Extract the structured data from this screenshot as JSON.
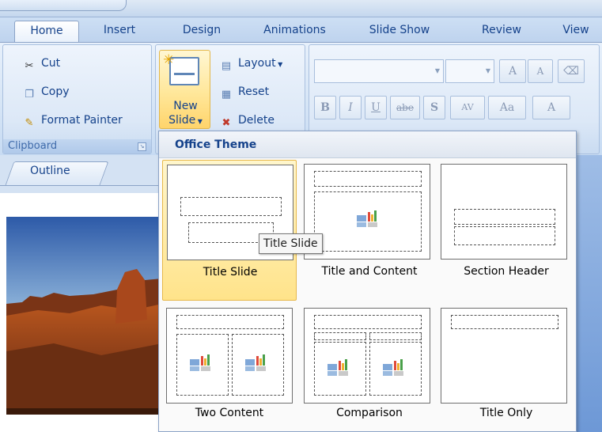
{
  "tabs": [
    {
      "label": "Home",
      "active": true
    },
    {
      "label": "Insert"
    },
    {
      "label": "Design"
    },
    {
      "label": "Animations"
    },
    {
      "label": "Slide Show"
    },
    {
      "label": "Review"
    },
    {
      "label": "View"
    }
  ],
  "clipboard": {
    "cut": "Cut",
    "copy": "Copy",
    "format_painter": "Format Painter",
    "group_label": "Clipboard"
  },
  "slides_group": {
    "new_slide_line1": "New",
    "new_slide_line2": "Slide",
    "layout": "Layout",
    "reset": "Reset",
    "delete": "Delete"
  },
  "font_group": {
    "bold": "B",
    "italic": "I",
    "underline": "U",
    "strike": "abe",
    "shadow": "S",
    "spacing": "AV",
    "change_case": "Aa",
    "grow": "A",
    "shrink": "A",
    "font_color": "A"
  },
  "side_panel": {
    "outline_tab": "Outline"
  },
  "gallery": {
    "header": "Office Theme",
    "layouts": [
      {
        "name": "Title Slide",
        "selected": true
      },
      {
        "name": "Title and Content"
      },
      {
        "name": "Section Header"
      },
      {
        "name": "Two Content"
      },
      {
        "name": "Comparison"
      },
      {
        "name": "Title Only"
      }
    ]
  },
  "tooltip": "Title Slide",
  "colors": {
    "ribbon_text": "#15428b",
    "selected_fill": "#ffe38a",
    "selected_border": "#e7b84a"
  }
}
